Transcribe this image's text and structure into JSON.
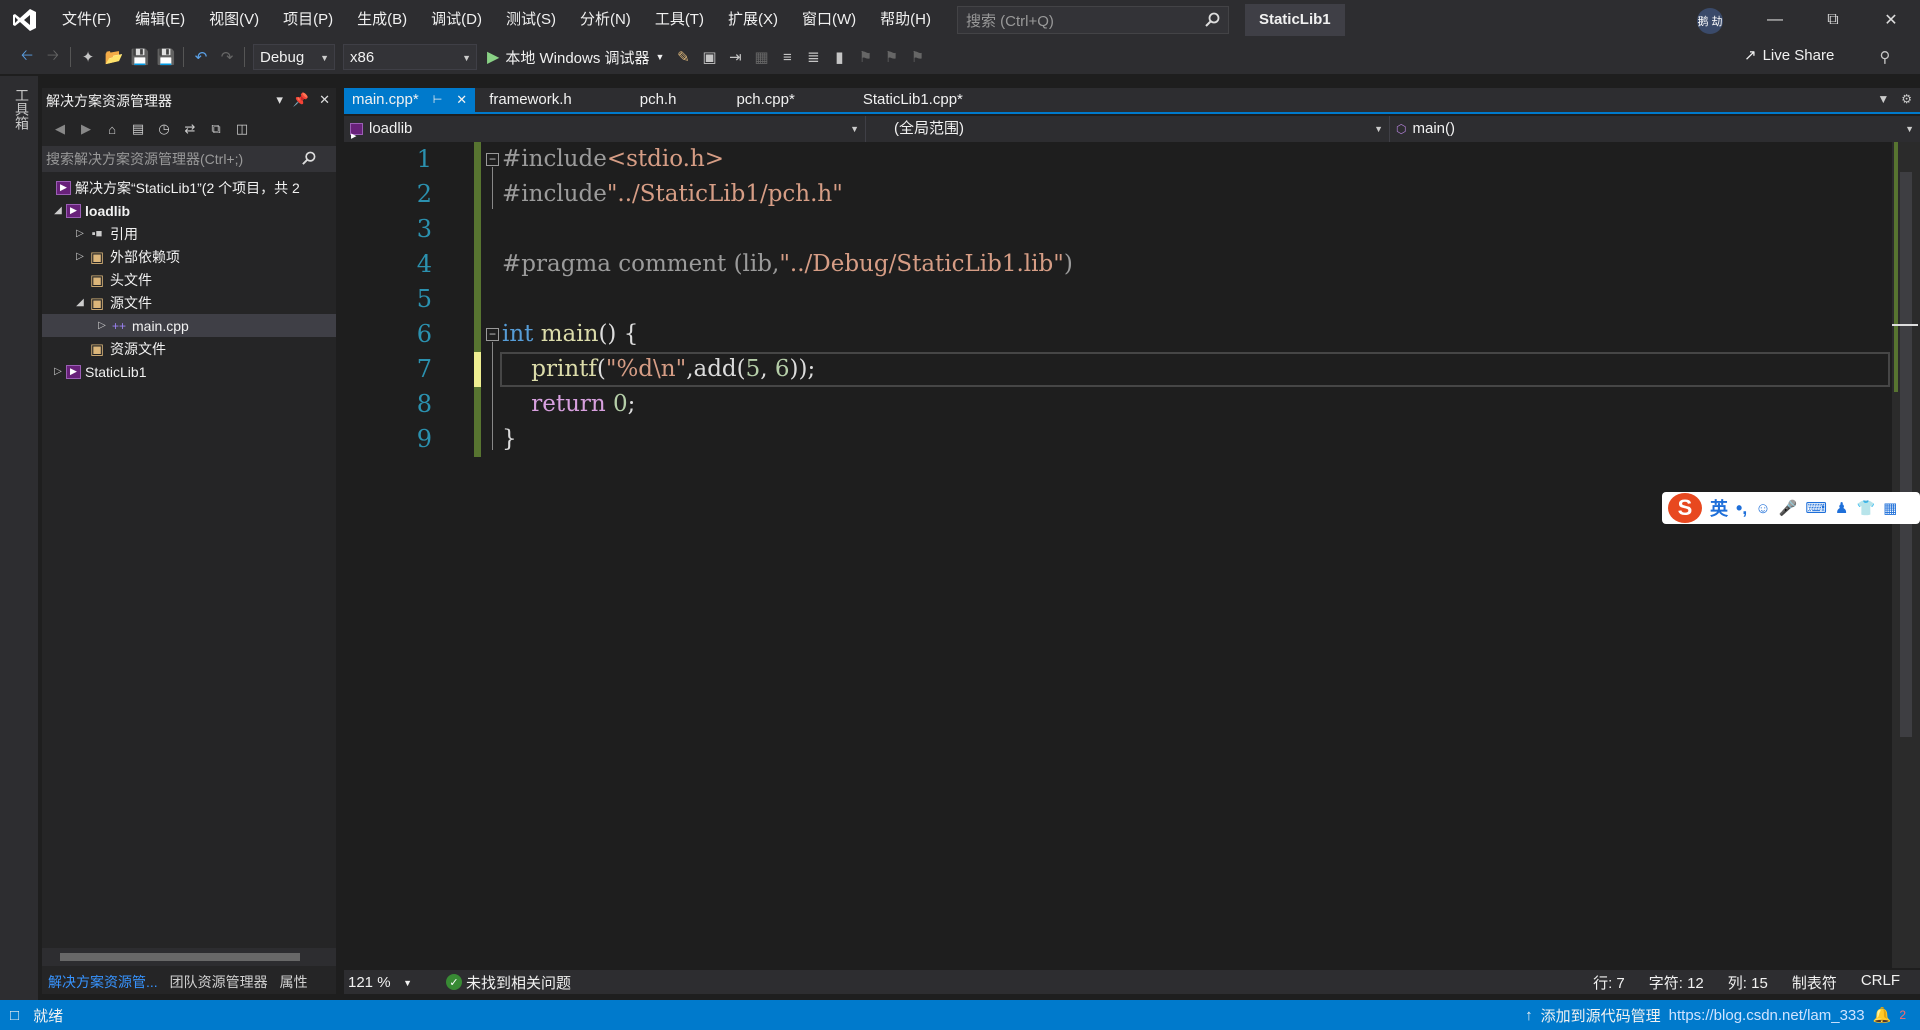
{
  "menu": {
    "items": [
      "文件(F)",
      "编辑(E)",
      "视图(V)",
      "项目(P)",
      "生成(B)",
      "调试(D)",
      "测试(S)",
      "分析(N)",
      "工具(T)",
      "扩展(X)",
      "窗口(W)",
      "帮助(H)"
    ],
    "search_placeholder": "搜索 (Ctrl+Q)",
    "solution_title": "StaticLib1",
    "user_initials": "鹅 劫"
  },
  "toolbar": {
    "config": "Debug",
    "platform": "x86",
    "run_label": "本地 Windows 调试器",
    "live_share": "Live Share"
  },
  "toolbox": {
    "label": "工具箱"
  },
  "solution_explorer": {
    "title": "解决方案资源管理器",
    "search_placeholder": "搜索解决方案资源管理器(Ctrl+;)",
    "tree": [
      {
        "label": "解决方案“StaticLib1”(2 个项目，共 2",
        "icon": "solution-icon"
      },
      {
        "label": "loadlib",
        "icon": "project-icon"
      },
      {
        "label": "引用",
        "icon": "references-icon"
      },
      {
        "label": "外部依赖项",
        "icon": "folder-icon"
      },
      {
        "label": "头文件",
        "icon": "folder-icon"
      },
      {
        "label": "源文件",
        "icon": "folder-icon"
      },
      {
        "label": "main.cpp",
        "icon": "cpp-file-icon"
      },
      {
        "label": "资源文件",
        "icon": "folder-icon"
      },
      {
        "label": "StaticLib1",
        "icon": "project-icon"
      }
    ],
    "bottom_tabs": [
      "解决方案资源管...",
      "团队资源管理器",
      "属性"
    ]
  },
  "editor": {
    "tabs": [
      "main.cpp*",
      "framework.h",
      "pch.h",
      "pch.cpp*",
      "StaticLib1.cpp*"
    ],
    "nav": {
      "project": "loadlib",
      "scope": "(全局范围)",
      "member": "main()"
    },
    "line_numbers": [
      "1",
      "2",
      "3",
      "4",
      "5",
      "6",
      "7",
      "8",
      "9"
    ],
    "zoom": "121 %",
    "issues": "未找到相关问题",
    "cursor": {
      "line": "行: 7",
      "char": "字符: 12",
      "col": "列: 15",
      "tab": "制表符",
      "eol": "CRLF"
    }
  },
  "code": {
    "l1_pp": "#include",
    "l1_str": "<stdio.h>",
    "l2_pp": "#include",
    "l2_str": "\"../StaticLib1/pch.h\"",
    "l4_pp": "#pragma comment (lib,",
    "l4_str": "\"../Debug/StaticLib1.lib\"",
    "l4_end": ")",
    "l6_kw": "int",
    "l6_fn": " main",
    "l6_rest": "() {",
    "l7_fn": "    printf",
    "l7_open": "(",
    "l7_str": "\"%d\\n\"",
    "l7_mid": ",add(",
    "l7_n1": "5",
    "l7_comma": ", ",
    "l7_n2": "6",
    "l7_end": "));",
    "l8_kw": "    return",
    "l8_sp": " ",
    "l8_num": "0",
    "l8_end": ";",
    "l9": "}"
  },
  "statusbar": {
    "ready": "就绪",
    "source_control": "添加到源代码管理",
    "watermark": "https://blog.csdn.net/lam_333",
    "notifications": "2"
  },
  "ime": {
    "mode": "英",
    "punct": "•,"
  },
  "colors": {
    "accent": "#007acc",
    "chrome": "#2d2d30",
    "editor_bg": "#1e1e1e",
    "keyword": "#569cd6",
    "string": "#d69d85",
    "line_number": "#2b91af"
  }
}
